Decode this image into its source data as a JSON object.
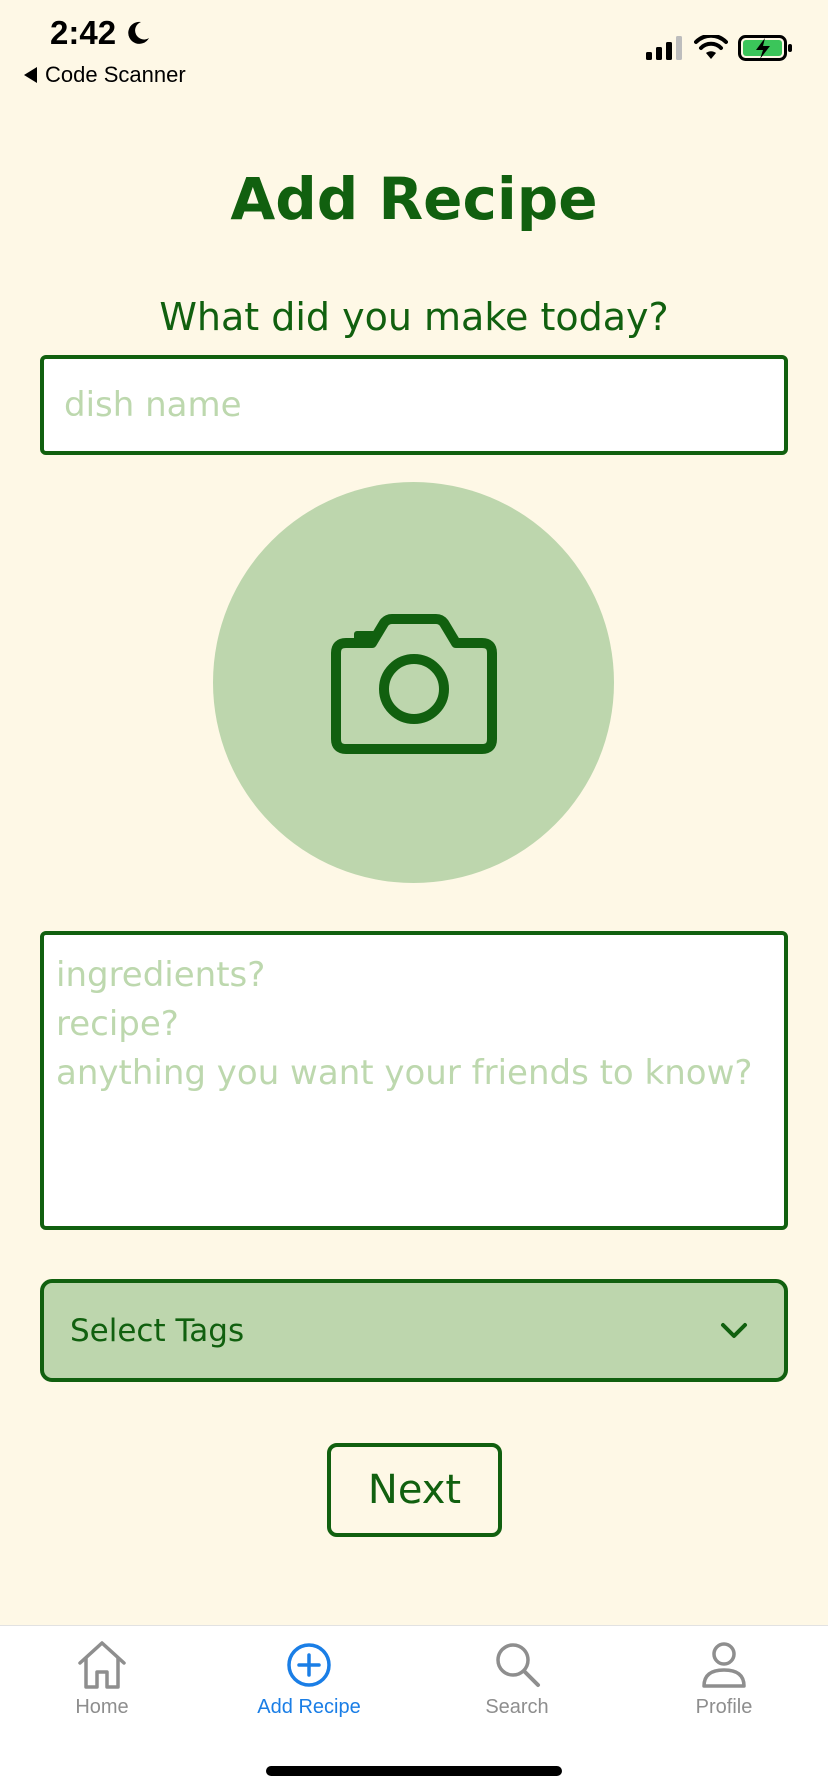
{
  "status_bar": {
    "time": "2:42",
    "back_app": "Code Scanner",
    "icons": [
      "moon-icon",
      "signal-icon",
      "wifi-icon",
      "battery-charging-icon"
    ]
  },
  "page": {
    "title": "Add Recipe",
    "prompt": "What did you make today?"
  },
  "form": {
    "dish_placeholder": "dish name",
    "dish_value": "",
    "notes_placeholder": "ingredients?\nrecipe?\nanything you want your friends to know?",
    "notes_value": "",
    "photo_icon": "camera-icon",
    "tags_label": "Select Tags",
    "next_label": "Next"
  },
  "tabbar": {
    "items": [
      {
        "label": "Home",
        "icon": "home-icon",
        "active": false
      },
      {
        "label": "Add Recipe",
        "icon": "plus-circle-icon",
        "active": true
      },
      {
        "label": "Search",
        "icon": "search-icon",
        "active": false
      },
      {
        "label": "Profile",
        "icon": "person-icon",
        "active": false
      }
    ]
  },
  "colors": {
    "background": "#fef8e6",
    "primary_green": "#11600f",
    "light_green": "#bdd6ad",
    "placeholder": "#bdd8ae",
    "tab_active": "#1a7ee6",
    "tab_inactive": "#8e8e8e"
  }
}
